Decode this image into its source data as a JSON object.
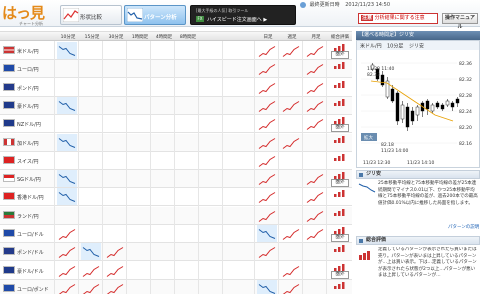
{
  "header": {
    "logo_text": "はっ見",
    "logo_sub": "チャート分析",
    "tabs": [
      {
        "label": "形状比較",
        "active": false
      },
      {
        "label": "パターン分析",
        "active": true
      },
      {
        "label": "売買シグナル",
        "active": false
      }
    ],
    "ad_line1": "[最大手級の人気] 取引ツール",
    "ad_badge": "FX",
    "ad_line2": "ハイスピード注文画面へ ▶",
    "updated_label": "最終更新日時",
    "updated_value": "2012/11/23 14:50",
    "note_badge": "注意",
    "note_text": "分析結果に関する注意",
    "manual_label": "操作マニュアル"
  },
  "grid": {
    "columns": [
      "",
      "10分足",
      "15分足",
      "30分足",
      "1時間足",
      "4時間足",
      "8時間足",
      "日足",
      "週足",
      "月足",
      "総合評価"
    ],
    "rows": [
      {
        "pair": "米ドル/円",
        "flag": "us",
        "highlight": [
          0
        ]
      },
      {
        "pair": "ユーロ/円",
        "flag": "eu",
        "highlight": []
      },
      {
        "pair": "ポンド/円",
        "flag": "uk",
        "highlight": []
      },
      {
        "pair": "豪ドル/円",
        "flag": "au",
        "highlight": [
          0
        ]
      },
      {
        "pair": "NZドル/円",
        "flag": "nz",
        "highlight": []
      },
      {
        "pair": "加ドル/円",
        "flag": "ca",
        "highlight": []
      },
      {
        "pair": "スイス/円",
        "flag": "ch",
        "highlight": []
      },
      {
        "pair": "SGドル/円",
        "flag": "sg",
        "highlight": []
      },
      {
        "pair": "香港ドル/円",
        "flag": "hk",
        "highlight": []
      },
      {
        "pair": "ランド/円",
        "flag": "za",
        "highlight": []
      },
      {
        "pair": "ユーロ/ドル",
        "flag": "eu",
        "highlight": []
      },
      {
        "pair": "ポンド/ドル",
        "flag": "uk",
        "highlight": []
      },
      {
        "pair": "豪ドル/ドル",
        "flag": "au",
        "highlight": []
      },
      {
        "pair": "ユーロ/ポンド",
        "flag": "eu",
        "highlight": []
      }
    ],
    "out_of_range_label": "圏外"
  },
  "panel": {
    "title": "【選べる時間足】ジリ安",
    "chart_pair": "米ドル/円",
    "chart_tf": "10分足",
    "chart_type": "ジリ安",
    "y_ticks": [
      "82.36",
      "82.32",
      "82.28",
      "82.24",
      "82.20",
      "82.16"
    ],
    "x_ticks": [
      "11/23 12:30",
      "11/23 14:10"
    ],
    "label_top": "11/23 11:40",
    "label_top_val": "82.33",
    "label_bot_val": "82.18",
    "label_bot_time": "11/23 14:00",
    "zoom_label": "拡大",
    "section1_title": "ジリ安",
    "section1_text": "25本移動平均線と75本移動平均線の差が25本連続期間でマイナス0.01以下、かつ25本移動平均線と75本移動平均線の差が、過去200本での最高値計価0.01%以内に推移した局面を指します。",
    "section1_link": "パターンの説明",
    "section2_title": "総合評価",
    "section2_text": "定義しているパターンが表示されたら買いまたは売り。パターンが表いまは上昇しているパターンが…上は買い表示。下は…定義しているパターンが表示されたら状態が2つ以上…パターンが悪いまは上昇しているパターンが…"
  }
}
